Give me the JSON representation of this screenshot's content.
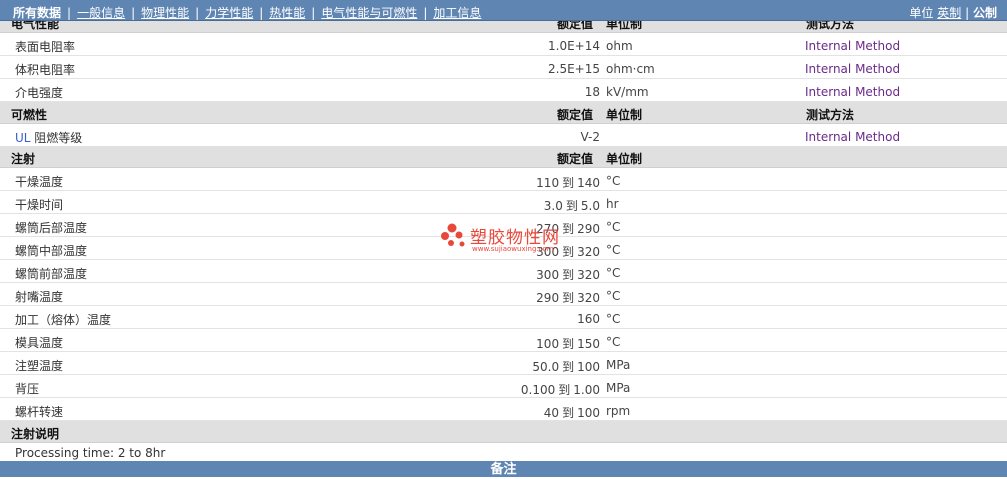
{
  "nav": {
    "items": [
      "所有数据",
      "一般信息",
      "物理性能",
      "力学性能",
      "热性能",
      "电气性能与可燃性",
      "加工信息"
    ],
    "separator": "|"
  },
  "units": {
    "label": "单位",
    "imperial": "英制",
    "separator": "|",
    "metric": "公制"
  },
  "headers": {
    "value": "额定值",
    "unit": "单位制",
    "method": "测试方法"
  },
  "electrical": {
    "title": "电气性能",
    "rows": [
      {
        "name": "表面电阻率",
        "value": "1.0E+14",
        "unit": "ohm",
        "method": "Internal Method"
      },
      {
        "name": "体积电阻率",
        "value": "2.5E+15",
        "unit": "ohm·cm",
        "method": "Internal Method"
      },
      {
        "name": "介电强度",
        "value": "18",
        "unit": "kV/mm",
        "method": "Internal Method"
      }
    ]
  },
  "flammability": {
    "title": "可燃性",
    "row": {
      "name_prefix": "UL",
      "name": " 阻燃等级",
      "value": "V-2",
      "unit": "",
      "method": "Internal Method"
    }
  },
  "injection": {
    "title": "注射",
    "to": "到",
    "rows": [
      {
        "name": "干燥温度",
        "min": "110",
        "max": "140",
        "unit": "°C"
      },
      {
        "name": "干燥时间",
        "min": "3.0",
        "max": "5.0",
        "unit": "hr"
      },
      {
        "name": "螺筒后部温度",
        "min": "270",
        "max": "290",
        "unit": "°C"
      },
      {
        "name": "螺筒中部温度",
        "min": "300",
        "max": "320",
        "unit": "°C"
      },
      {
        "name": "螺筒前部温度",
        "min": "300",
        "max": "320",
        "unit": "°C"
      },
      {
        "name": "射嘴温度",
        "min": "290",
        "max": "320",
        "unit": "°C"
      },
      {
        "name": "加工（熔体）温度",
        "single": "160",
        "unit": "°C"
      },
      {
        "name": "模具温度",
        "min": "100",
        "max": "150",
        "unit": "°C"
      },
      {
        "name": "注塑温度",
        "min": "50.0",
        "max": "100",
        "unit": "MPa"
      },
      {
        "name": "背压",
        "min": "0.100",
        "max": "1.00",
        "unit": "MPa"
      },
      {
        "name": "螺杆转速",
        "min": "40",
        "max": "100",
        "unit": "rpm"
      }
    ]
  },
  "injection_notes": {
    "title": "注射说明",
    "text": "Processing time: 2 to 8hr"
  },
  "footer": {
    "label": "备注"
  },
  "watermark": {
    "title": "塑胶物性网",
    "url": "www.sujiaowuxing.com"
  },
  "colors": {
    "topbar": "#5f85b3",
    "section": "#e0e0e0",
    "method_text": "#6b2a8a",
    "watermark": "#e8483a"
  }
}
